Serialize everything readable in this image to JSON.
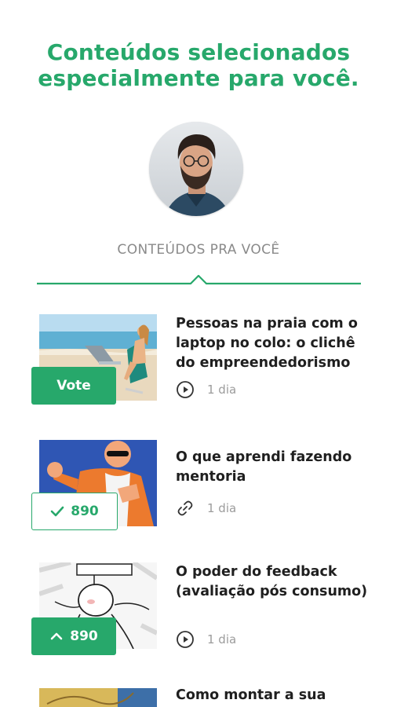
{
  "header": {
    "line1": "Conteúdos selecionados",
    "line2": "especialmente para você."
  },
  "tab": {
    "label": "CONTEÚDOS PRA VOCÊ"
  },
  "colors": {
    "accent": "#27a86b",
    "text": "#1f1f1f",
    "muted": "#9c9c9c"
  },
  "items": [
    {
      "title": "Pessoas na praia com o laptop no colo: o clichê do empreendedorismo",
      "meta_icon": "play-circle-icon",
      "meta_text": "1 dia",
      "vote_label": "Vote",
      "vote_state": "unvoted"
    },
    {
      "title": "O que aprendi fazendo mentoria",
      "meta_icon": "link-icon",
      "meta_text": "1 dia",
      "vote_label": "890",
      "vote_state": "voted"
    },
    {
      "title": "O poder do feedback (avaliação pós consumo)",
      "meta_icon": "play-circle-icon",
      "meta_text": "1 dia",
      "vote_label": "890",
      "vote_state": "upvoted"
    },
    {
      "title": "Como montar a sua"
    }
  ]
}
